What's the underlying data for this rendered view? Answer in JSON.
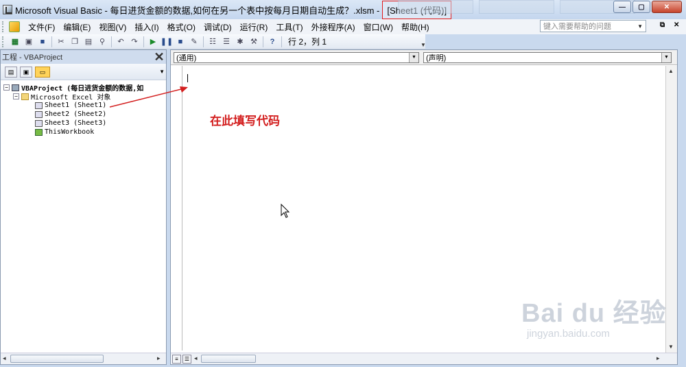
{
  "window": {
    "title_main": "Microsoft Visual Basic - 每日进货金额的数据,如何在另一个表中按每月日期自动生成？.xlsm - ",
    "title_highlight": "[Sheet1 (代码)]",
    "controls": {
      "minimize": "—",
      "maximize": "▢",
      "close": "✕"
    }
  },
  "menubar": {
    "items": [
      "文件(F)",
      "编辑(E)",
      "视图(V)",
      "插入(I)",
      "格式(O)",
      "调试(D)",
      "运行(R)",
      "工具(T)",
      "外接程序(A)",
      "窗口(W)",
      "帮助(H)"
    ],
    "help_placeholder": "键入需要帮助的问题",
    "min_label": "‒",
    "restore_label": "⧉",
    "close_label": "✕"
  },
  "toolbar": {
    "cursor_position": "行 2，列 1"
  },
  "project": {
    "title": "工程 - VBAProject",
    "close_label": "✕",
    "tree": [
      {
        "label": "VBAProject (每日进货金额的数据,如",
        "level": 0
      },
      {
        "label": "Microsoft Excel 对象",
        "level": 1
      },
      {
        "label": "Sheet1 (Sheet1)",
        "level": 2
      },
      {
        "label": "Sheet2 (Sheet2)",
        "level": 2
      },
      {
        "label": "Sheet3 (Sheet3)",
        "level": 2
      },
      {
        "label": "ThisWorkbook",
        "level": 2
      }
    ]
  },
  "code": {
    "object_combo": "(通用)",
    "proc_combo": "(声明)",
    "annotation": "在此填写代码"
  },
  "watermark": {
    "main": "Bai du 经验",
    "sub": "jingyan.baidu.com"
  },
  "colors": {
    "highlight_box": "#e21b1b",
    "annotation_text": "#d31e1e",
    "chrome_blue": "#c9d9ee"
  }
}
